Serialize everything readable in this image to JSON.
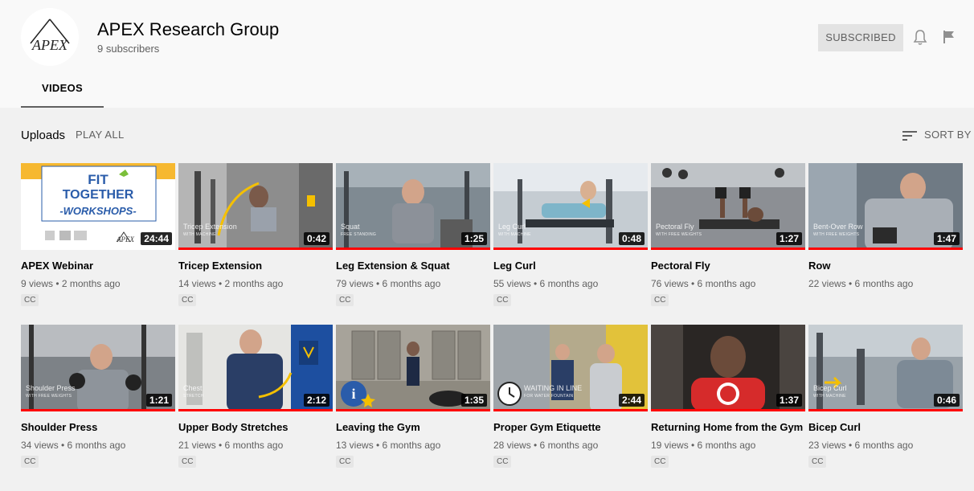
{
  "channel": {
    "name": "APEX Research Group",
    "subscribers": "9 subscribers",
    "logo_text": "APEX",
    "subscribe_label": "SUBSCRIBED"
  },
  "tabs": [
    {
      "label": "VIDEOS",
      "active": true
    }
  ],
  "section": {
    "title": "Uploads",
    "play_all": "PLAY ALL",
    "sort_label": "SORT BY"
  },
  "icons": {
    "bell": "bell-icon",
    "flag": "flag-icon",
    "sort": "sort-icon"
  },
  "thumb_texts": {
    "webinar_line1": "FIT",
    "webinar_line2": "TOGETHER",
    "webinar_line3": "-WORKSHOPS-",
    "webinar_logo": "APEX",
    "tricep_label": "Tricep Extension",
    "tricep_sub": "WITH MACHINE",
    "squat_label": "Squat",
    "squat_sub": "FREE STANDING",
    "legcurl_label": "Leg Curl",
    "legcurl_sub": "WITH MACHINE",
    "pectoral_label": "Pectoral Fly",
    "pectoral_sub": "WITH FREE WEIGHTS",
    "row_label": "Bent-Over Row",
    "row_sub": "WITH FREE WEIGHTS",
    "shoulder_label": "Shoulder Press",
    "shoulder_sub": "WITH FREE WEIGHTS",
    "chest_label": "Chest",
    "chest_sub": "STRETCH",
    "waiting_label": "WAITING IN LINE",
    "waiting_sub": "FOR WATER FOUNTAIN",
    "bicep_label": "Bicep Curl",
    "bicep_sub": "WITH MACHINE"
  },
  "videos": [
    {
      "title": "APEX Webinar",
      "meta": "9 views • 2 months ago",
      "duration": "24:44",
      "cc": "CC"
    },
    {
      "title": "Tricep Extension",
      "meta": "14 views • 2 months ago",
      "duration": "0:42",
      "cc": "CC"
    },
    {
      "title": "Leg Extension & Squat",
      "meta": "79 views • 6 months ago",
      "duration": "1:25",
      "cc": "CC"
    },
    {
      "title": "Leg Curl",
      "meta": "55 views • 6 months ago",
      "duration": "0:48",
      "cc": "CC"
    },
    {
      "title": "Pectoral Fly",
      "meta": "76 views • 6 months ago",
      "duration": "1:27",
      "cc": "CC"
    },
    {
      "title": "Row",
      "meta": "22 views • 6 months ago",
      "duration": "1:47",
      "cc": ""
    },
    {
      "title": "Shoulder Press",
      "meta": "34 views • 6 months ago",
      "duration": "1:21",
      "cc": "CC"
    },
    {
      "title": "Upper Body Stretches",
      "meta": "21 views • 6 months ago",
      "duration": "2:12",
      "cc": "CC"
    },
    {
      "title": "Leaving the Gym",
      "meta": "13 views • 6 months ago",
      "duration": "1:35",
      "cc": "CC"
    },
    {
      "title": "Proper Gym Etiquette",
      "meta": "28 views • 6 months ago",
      "duration": "2:44",
      "cc": "CC"
    },
    {
      "title": "Returning Home from the Gym",
      "meta": "19 views • 6 months ago",
      "duration": "1:37",
      "cc": "CC"
    },
    {
      "title": "Bicep Curl",
      "meta": "23 views • 6 months ago",
      "duration": "0:46",
      "cc": "CC"
    }
  ]
}
